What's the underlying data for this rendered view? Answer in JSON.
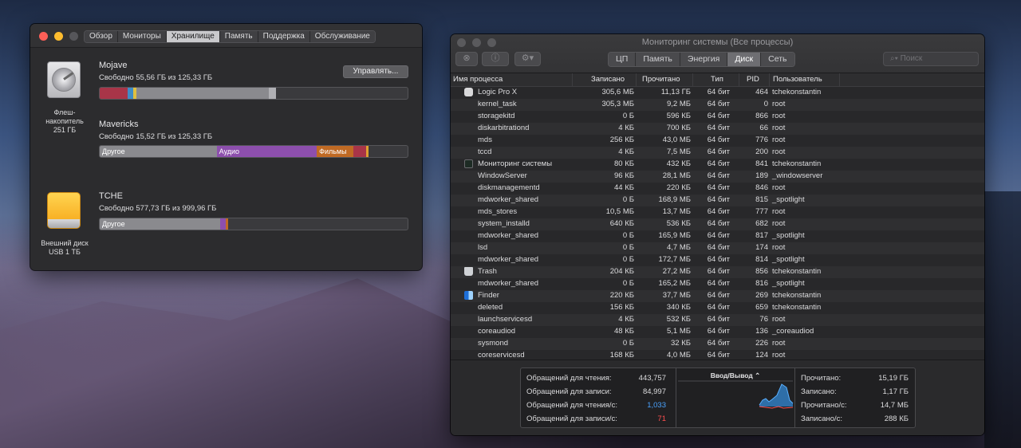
{
  "storage_window": {
    "tabs": [
      "Обзор",
      "Мониторы",
      "Хранилище",
      "Память",
      "Поддержка",
      "Обслуживание"
    ],
    "active_tab": 2,
    "manage_button": "Управлять...",
    "disks": [
      {
        "name": "Mojave",
        "free": "Свободно 55,56 ГБ из 125,33 ГБ",
        "device_label": [
          "Флеш-",
          "накопитель",
          "251 ГБ"
        ],
        "segments": [
          {
            "label": "",
            "fraction": 0.09,
            "color": "#a83548"
          },
          {
            "label": "",
            "fraction": 0.02,
            "color": "#3f8dc7"
          },
          {
            "label": "",
            "fraction": 0.008,
            "color": "#e0c040"
          },
          {
            "label": "",
            "fraction": 0.43,
            "color": "#8a8a8e"
          },
          {
            "label": "",
            "fraction": 0.025,
            "color": "#b0b0b4"
          }
        ]
      },
      {
        "name": "Mavericks",
        "free": "Свободно 15,52 ГБ из 125,33 ГБ",
        "segments": [
          {
            "label": "Другое",
            "fraction": 0.38,
            "color": "#8a8a8e"
          },
          {
            "label": "Аудио",
            "fraction": 0.325,
            "color": "#8d4fad"
          },
          {
            "label": "Фильмы",
            "fraction": 0.12,
            "color": "#c06a24"
          },
          {
            "label": "",
            "fraction": 0.04,
            "color": "#a83548"
          },
          {
            "label": "",
            "fraction": 0.008,
            "color": "#e0a030"
          }
        ]
      },
      {
        "name": "TCHE",
        "free": "Свободно 577,73 ГБ из 999,96 ГБ",
        "device_label": [
          "Внешний диск",
          "USB 1 ТБ"
        ],
        "segments": [
          {
            "label": "Другое",
            "fraction": 0.39,
            "color": "#8a8a8e"
          },
          {
            "label": "",
            "fraction": 0.02,
            "color": "#8d4fad"
          },
          {
            "label": "",
            "fraction": 0.008,
            "color": "#c06a24"
          }
        ]
      }
    ]
  },
  "monitor": {
    "title": "Мониторинг системы (Все процессы)",
    "tabs": [
      "ЦП",
      "Память",
      "Энергия",
      "Диск",
      "Сеть"
    ],
    "active_tab": 3,
    "search_placeholder": "Поиск",
    "columns": [
      "Имя процесса",
      "Записано",
      "Прочитано",
      "Тип",
      "PID",
      "Пользователь"
    ],
    "rows": [
      {
        "icon": "logic-pro-icon",
        "name": "Logic Pro X",
        "w": "305,6 МБ",
        "r": "11,13 ГБ",
        "t": "64 бит",
        "pid": "464",
        "user": "tchekonstantin"
      },
      {
        "name": "kernel_task",
        "w": "305,3 МБ",
        "r": "9,2 МБ",
        "t": "64 бит",
        "pid": "0",
        "user": "root"
      },
      {
        "name": "storagekitd",
        "w": "0 Б",
        "r": "596 КБ",
        "t": "64 бит",
        "pid": "866",
        "user": "root"
      },
      {
        "name": "diskarbitrationd",
        "w": "4 КБ",
        "r": "700 КБ",
        "t": "64 бит",
        "pid": "66",
        "user": "root"
      },
      {
        "name": "mds",
        "w": "256 КБ",
        "r": "43,0 МБ",
        "t": "64 бит",
        "pid": "776",
        "user": "root"
      },
      {
        "name": "tccd",
        "w": "4 КБ",
        "r": "7,5 МБ",
        "t": "64 бит",
        "pid": "200",
        "user": "root"
      },
      {
        "icon": "activity-monitor-icon",
        "name": "Мониторинг системы",
        "w": "80 КБ",
        "r": "432 КБ",
        "t": "64 бит",
        "pid": "841",
        "user": "tchekonstantin"
      },
      {
        "name": "WindowServer",
        "w": "96 КБ",
        "r": "28,1 МБ",
        "t": "64 бит",
        "pid": "189",
        "user": "_windowserver"
      },
      {
        "name": "diskmanagementd",
        "w": "44 КБ",
        "r": "220 КБ",
        "t": "64 бит",
        "pid": "846",
        "user": "root"
      },
      {
        "name": "mdworker_shared",
        "w": "0 Б",
        "r": "168,9 МБ",
        "t": "64 бит",
        "pid": "815",
        "user": "_spotlight"
      },
      {
        "name": "mds_stores",
        "w": "10,5 МБ",
        "r": "13,7 МБ",
        "t": "64 бит",
        "pid": "777",
        "user": "root"
      },
      {
        "name": "system_installd",
        "w": "640 КБ",
        "r": "536 КБ",
        "t": "64 бит",
        "pid": "682",
        "user": "root"
      },
      {
        "name": "mdworker_shared",
        "w": "0 Б",
        "r": "165,9 МБ",
        "t": "64 бит",
        "pid": "817",
        "user": "_spotlight"
      },
      {
        "name": "lsd",
        "w": "0 Б",
        "r": "4,7 МБ",
        "t": "64 бит",
        "pid": "174",
        "user": "root"
      },
      {
        "name": "mdworker_shared",
        "w": "0 Б",
        "r": "172,7 МБ",
        "t": "64 бит",
        "pid": "814",
        "user": "_spotlight"
      },
      {
        "icon": "trash-icon",
        "name": "Trash",
        "w": "204 КБ",
        "r": "27,2 МБ",
        "t": "64 бит",
        "pid": "856",
        "user": "tchekonstantin"
      },
      {
        "name": "mdworker_shared",
        "w": "0 Б",
        "r": "165,2 МБ",
        "t": "64 бит",
        "pid": "816",
        "user": "_spotlight"
      },
      {
        "icon": "finder-icon",
        "name": "Finder",
        "w": "220 КБ",
        "r": "37,7 МБ",
        "t": "64 бит",
        "pid": "269",
        "user": "tchekonstantin"
      },
      {
        "name": "deleted",
        "w": "156 КБ",
        "r": "340 КБ",
        "t": "64 бит",
        "pid": "659",
        "user": "tchekonstantin"
      },
      {
        "name": "launchservicesd",
        "w": "4 КБ",
        "r": "532 КБ",
        "t": "64 бит",
        "pid": "76",
        "user": "root"
      },
      {
        "name": "coreaudiod",
        "w": "48 КБ",
        "r": "5,1 МБ",
        "t": "64 бит",
        "pid": "136",
        "user": "_coreaudiod"
      },
      {
        "name": "sysmond",
        "w": "0 Б",
        "r": "32 КБ",
        "t": "64 бит",
        "pid": "226",
        "user": "root"
      },
      {
        "name": "coreservicesd",
        "w": "168 КБ",
        "r": "4,0 МБ",
        "t": "64 бит",
        "pid": "124",
        "user": "root"
      }
    ],
    "stats_left": [
      {
        "label": "Обращений для чтения:",
        "value": "443,757",
        "color": "#dcdcde"
      },
      {
        "label": "Обращений для записи:",
        "value": "84,997",
        "color": "#dcdcde"
      },
      {
        "label": "Обращений для чтения/с:",
        "value": "1,033",
        "color": "#4aa3ff"
      },
      {
        "label": "Обращений для записи/с:",
        "value": "71",
        "color": "#ff4f4f"
      }
    ],
    "io_title": "Ввод/Вывод",
    "stats_right": [
      {
        "label": "Прочитано:",
        "value": "15,19 ГБ"
      },
      {
        "label": "Записано:",
        "value": "1,17 ГБ"
      },
      {
        "label": "Прочитано/с:",
        "value": "14,7 МБ"
      },
      {
        "label": "Записано/с:",
        "value": "288 КБ"
      }
    ]
  }
}
